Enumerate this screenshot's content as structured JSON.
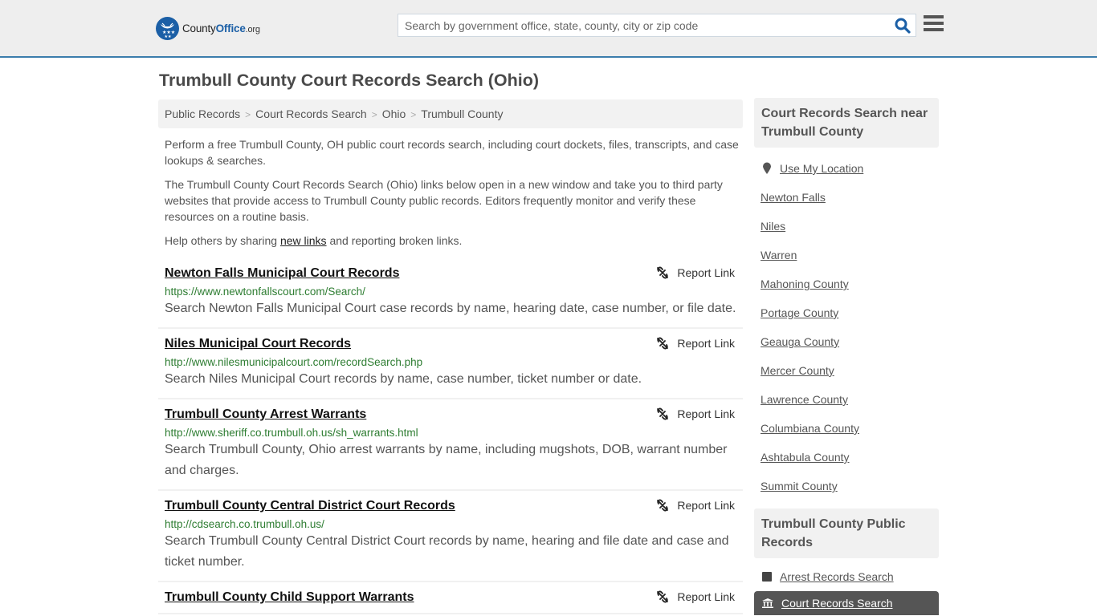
{
  "header": {
    "logo": {
      "part1": "County",
      "part2": "Office",
      "part3": ".org"
    },
    "search_placeholder": "Search by government office, state, county, city or zip code",
    "search_value": "",
    "search_icon": "magnifier-icon",
    "menu_icon": "hamburger-icon"
  },
  "page": {
    "title": "Trumbull County Court Records Search (Ohio)"
  },
  "breadcrumb": [
    "Public Records",
    "Court Records Search",
    "Ohio",
    "Trumbull County"
  ],
  "intro": {
    "p1": "Perform a free Trumbull County, OH public court records search, including court dockets, files, transcripts, and case lookups & searches.",
    "p2": "The Trumbull County Court Records Search (Ohio) links below open in a new window and take you to third party websites that provide access to Trumbull County public records. Editors frequently monitor and verify these resources on a routine basis.",
    "p3_before": "Help others by sharing ",
    "p3_link": "new links",
    "p3_after": " and reporting broken links."
  },
  "report_label": "Report Link",
  "results": [
    {
      "title": "Newton Falls Municipal Court Records",
      "url": "https://www.newtonfallscourt.com/Search/",
      "desc": "Search Newton Falls Municipal Court case records by name, hearing date, case number, or file date."
    },
    {
      "title": "Niles Municipal Court Records",
      "url": "http://www.nilesmunicipalcourt.com/recordSearch.php",
      "desc": "Search Niles Municipal Court records by name, case number, ticket number or date."
    },
    {
      "title": "Trumbull County Arrest Warrants",
      "url": "http://www.sheriff.co.trumbull.oh.us/sh_warrants.html",
      "desc": "Search Trumbull County, Ohio arrest warrants by name, including mugshots, DOB, warrant number and charges."
    },
    {
      "title": "Trumbull County Central District Court Records",
      "url": "http://cdsearch.co.trumbull.oh.us/",
      "desc": "Search Trumbull County Central District Court records by name, hearing and file date and case and ticket number."
    },
    {
      "title": "Trumbull County Child Support Warrants",
      "url": "",
      "desc": ""
    }
  ],
  "sidebar": {
    "near_heading": "Court Records Search near Trumbull County",
    "use_location": "Use My Location",
    "near_links": [
      "Newton Falls",
      "Niles",
      "Warren",
      "Mahoning County",
      "Portage County",
      "Geauga County",
      "Mercer County",
      "Lawrence County",
      "Columbiana County",
      "Ashtabula County",
      "Summit County"
    ],
    "public_heading": "Trumbull County Public Records",
    "public_links": [
      {
        "label": "Arrest Records Search",
        "icon": "square-icon",
        "active": false
      },
      {
        "label": "Court Records Search",
        "icon": "courthouse-icon",
        "active": true
      }
    ]
  },
  "colors": {
    "brand": "#1b5fa6",
    "header_bg": "#eeeeee",
    "header_border": "#3b7dac",
    "url_green": "#2e7d32"
  }
}
